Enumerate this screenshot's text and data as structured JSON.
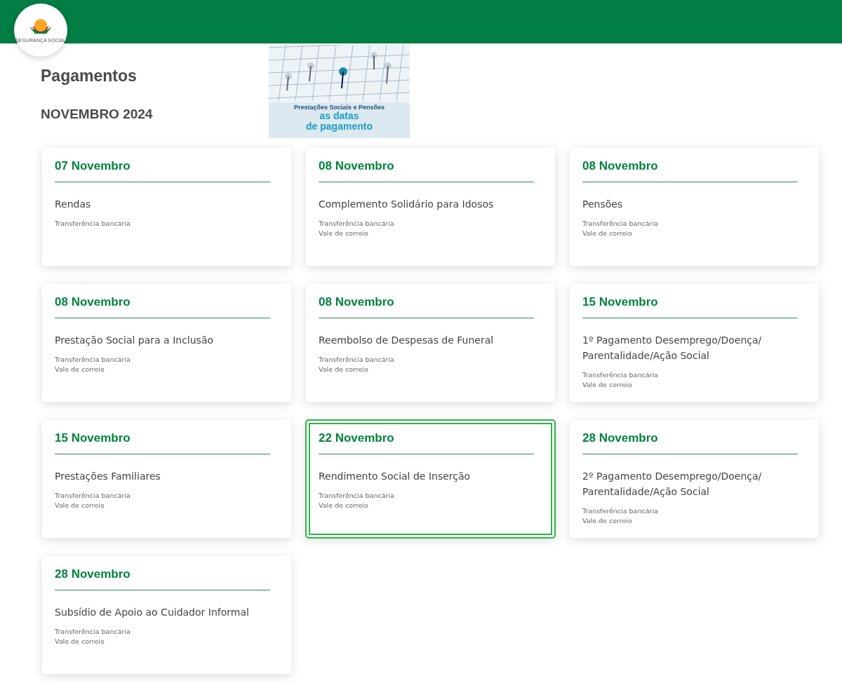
{
  "logo": {
    "text": "SEGURANÇA SOCIAL"
  },
  "page_title": "Pagamentos",
  "month_heading": "NOVEMBRO 2024",
  "banner": {
    "line_1": "Prestações Sociais e Pensões",
    "line_2": "as datas",
    "line_3": "de pagamento"
  },
  "cards": [
    {
      "date": "07 Novembro",
      "title_lines": [
        "Rendas"
      ],
      "methods": [
        "Transferência bancária"
      ],
      "selected": false
    },
    {
      "date": "08 Novembro",
      "title_lines": [
        "Complemento Solidário para Idosos"
      ],
      "methods": [
        "Transferência bancária",
        "Vale de correio"
      ],
      "selected": false
    },
    {
      "date": "08 Novembro",
      "title_lines": [
        "Pensões"
      ],
      "methods": [
        "Transferência bancária",
        "Vale de correio"
      ],
      "selected": false
    },
    {
      "date": "08 Novembro",
      "title_lines": [
        "Prestação Social para a Inclusão"
      ],
      "methods": [
        "Transferência bancária",
        "Vale de correio"
      ],
      "selected": false
    },
    {
      "date": "08 Novembro",
      "title_lines": [
        "Reembolso de Despesas de Funeral"
      ],
      "methods": [
        "Transferência bancária",
        "Vale de correio"
      ],
      "selected": false
    },
    {
      "date": "15 Novembro",
      "title_lines": [
        "1º Pagamento Desemprego/Doença/",
        "Parentalidade/Ação Social"
      ],
      "methods": [
        "Transferência bancária",
        "Vale de correio"
      ],
      "selected": false
    },
    {
      "date": "15 Novembro",
      "title_lines": [
        "Prestações Familiares"
      ],
      "methods": [
        "Transferência bancária",
        "Vale de correio"
      ],
      "selected": false
    },
    {
      "date": "22 Novembro",
      "title_lines": [
        "Rendimento Social de Inserção"
      ],
      "methods": [
        "Transferência bancária",
        "Vale de correio"
      ],
      "selected": true
    },
    {
      "date": "28 Novembro",
      "title_lines": [
        "2º Pagamento Desemprego/Doença/",
        "Parentalidade/Ação Social"
      ],
      "methods": [
        "Transferência bancária",
        "Vale de correio"
      ],
      "selected": false
    },
    {
      "date": "28 Novembro",
      "title_lines": [
        "Subsídio de Apoio ao Cuidador Informal"
      ],
      "methods": [
        "Transferência bancária",
        "Vale de correio"
      ],
      "selected": false
    }
  ]
}
